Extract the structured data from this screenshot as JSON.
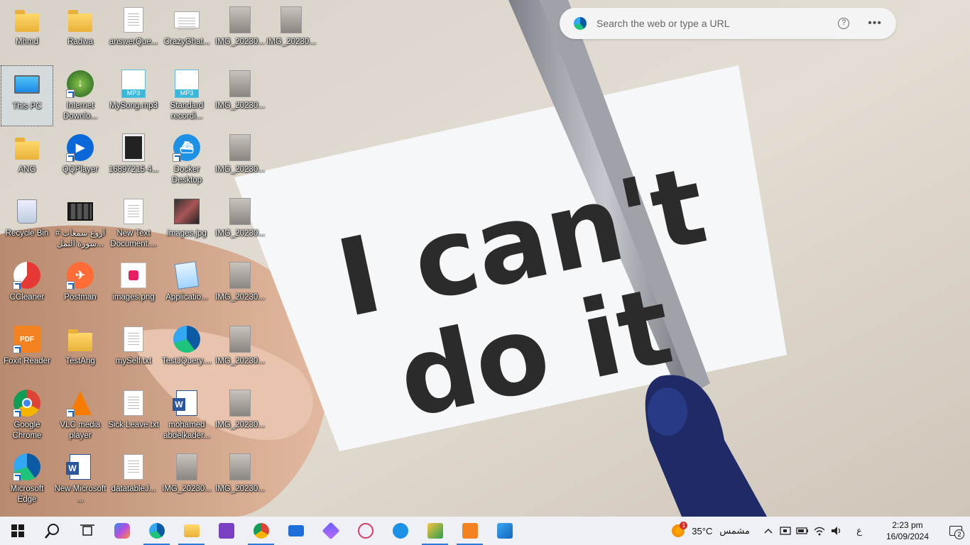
{
  "desktop": {
    "icons": [
      {
        "label": "Mhmd",
        "icon": "user-folder-icon"
      },
      {
        "label": "Radwa",
        "icon": "folder-icon"
      },
      {
        "label": "answerQue...",
        "icon": "document-icon"
      },
      {
        "label": "CrazyGhat...",
        "icon": "image-icon"
      },
      {
        "label": "IMG_20230...",
        "icon": "photo-thumbnail-icon"
      },
      {
        "label": "IMG_20230...",
        "icon": "photo-thumbnail-icon"
      },
      {
        "label": "This PC",
        "icon": "computer-icon"
      },
      {
        "label": "Internet Downlo...",
        "icon": "download-manager-icon"
      },
      {
        "label": "MySong.mp3",
        "icon": "mp3-file-icon"
      },
      {
        "label": "Standard recordi...",
        "icon": "mp3-file-icon"
      },
      {
        "label": "IMG_20230...",
        "icon": "photo-thumbnail-icon"
      },
      {
        "label": "ANG",
        "icon": "folder-icon"
      },
      {
        "label": "QQPlayer",
        "icon": "qqplayer-icon"
      },
      {
        "label": "16897215 4...",
        "icon": "image-file-icon"
      },
      {
        "label": "Docker Desktop",
        "icon": "docker-icon"
      },
      {
        "label": "IMG_20230...",
        "icon": "photo-thumbnail-icon"
      },
      {
        "label": "Recycle Bin",
        "icon": "recycle-bin-icon"
      },
      {
        "label": "# أروع سمعات سورة النمل...",
        "icon": "video-file-icon"
      },
      {
        "label": "New Text Document....",
        "icon": "text-file-icon"
      },
      {
        "label": "images.jpg",
        "icon": "jpg-image-icon"
      },
      {
        "label": "IMG_20230...",
        "icon": "photo-thumbnail-icon"
      },
      {
        "label": "CCleaner",
        "icon": "ccleaner-icon"
      },
      {
        "label": "Postman",
        "icon": "postman-icon"
      },
      {
        "label": "images.png",
        "icon": "png-image-icon"
      },
      {
        "label": "Applicatio...",
        "icon": "notepad-icon"
      },
      {
        "label": "IMG_20230...",
        "icon": "photo-thumbnail-icon"
      },
      {
        "label": "Foxit Reader",
        "icon": "foxit-reader-icon"
      },
      {
        "label": "TestAng",
        "icon": "folder-icon"
      },
      {
        "label": "mySelf.txt",
        "icon": "text-file-icon"
      },
      {
        "label": "TestJQuery....",
        "icon": "edge-html-icon"
      },
      {
        "label": "IMG_20230...",
        "icon": "photo-thumbnail-icon"
      },
      {
        "label": "Google Chrome",
        "icon": "chrome-icon"
      },
      {
        "label": "VLC media player",
        "icon": "vlc-icon"
      },
      {
        "label": "Sick Leave.txt",
        "icon": "text-file-icon"
      },
      {
        "label": "mohamed abdelkader...",
        "icon": "word-document-icon"
      },
      {
        "label": "IMG_20230...",
        "icon": "photo-thumbnail-icon"
      },
      {
        "label": "Microsoft Edge",
        "icon": "edge-icon"
      },
      {
        "label": "New Microsoft ...",
        "icon": "word-document-icon"
      },
      {
        "label": "datatableJ...",
        "icon": "text-file-icon"
      },
      {
        "label": "IMG_20230...",
        "icon": "photo-thumbnail-icon"
      },
      {
        "label": "IMG_20230...",
        "icon": "photo-thumbnail-icon"
      }
    ]
  },
  "wallpaper": {
    "line1": "I can't",
    "line2": "do it"
  },
  "search": {
    "placeholder": "Search the web or type a URL",
    "help_icon": "help-icon",
    "more_icon": "more-icon"
  },
  "taskbar": {
    "items": [
      {
        "name": "start-button",
        "icon": "windows-logo-icon"
      },
      {
        "name": "search-button",
        "icon": "search-icon"
      },
      {
        "name": "task-view-button",
        "icon": "task-view-icon"
      },
      {
        "name": "copilot-button",
        "icon": "copilot-icon"
      },
      {
        "name": "edge-taskbar",
        "icon": "edge-icon"
      },
      {
        "name": "file-explorer-taskbar",
        "icon": "folder-icon"
      },
      {
        "name": "visual-studio-taskbar",
        "icon": "visual-studio-icon"
      },
      {
        "name": "chrome-taskbar",
        "icon": "chrome-icon"
      },
      {
        "name": "mail-taskbar",
        "icon": "mail-icon"
      },
      {
        "name": "app-taskbar",
        "icon": "hex-app-icon"
      },
      {
        "name": "snipping-taskbar",
        "icon": "snipping-icon"
      },
      {
        "name": "docker-taskbar",
        "icon": "docker-icon"
      },
      {
        "name": "tool-taskbar",
        "icon": "tool-icon"
      },
      {
        "name": "foxit-taskbar",
        "icon": "foxit-reader-icon"
      },
      {
        "name": "photos-taskbar",
        "icon": "photos-icon"
      }
    ],
    "colors": {
      "accent": "#2c7bd8",
      "background": "#eef0f5"
    }
  },
  "tray": {
    "weather_badge": "1",
    "temperature": "35°C",
    "condition": "مشمس",
    "language": "ع",
    "time": "2:23 pm",
    "date": "16/09/2024",
    "notification_count": "2"
  }
}
